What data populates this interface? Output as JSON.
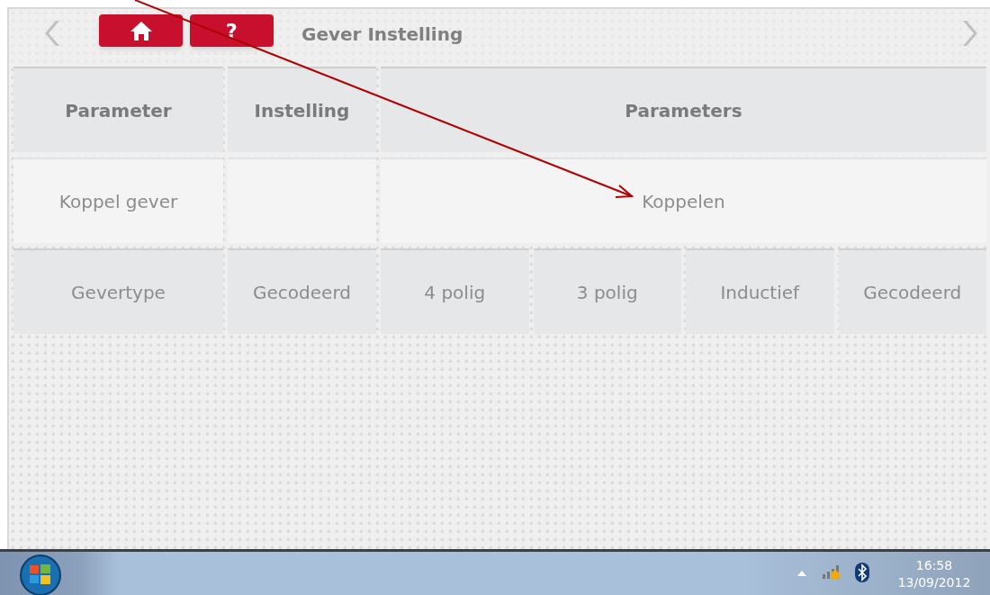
{
  "header": {
    "title": "Gever Instelling",
    "help_label": "?"
  },
  "table": {
    "columns": [
      "Parameter",
      "Instelling",
      "Parameters"
    ],
    "rows": [
      {
        "label": "Koppel gever",
        "setting": "",
        "options": [
          {
            "label": "Koppelen",
            "wide": true
          }
        ]
      },
      {
        "label": "Gevertype",
        "setting": "Gecodeerd",
        "options": [
          {
            "label": "4 polig",
            "wide": false
          },
          {
            "label": "3 polig",
            "wide": false
          },
          {
            "label": "Inductief",
            "wide": false
          },
          {
            "label": "Gecodeerd",
            "wide": false
          }
        ]
      }
    ]
  },
  "taskbar": {
    "time": "16:58",
    "date": "13/09/2012"
  }
}
